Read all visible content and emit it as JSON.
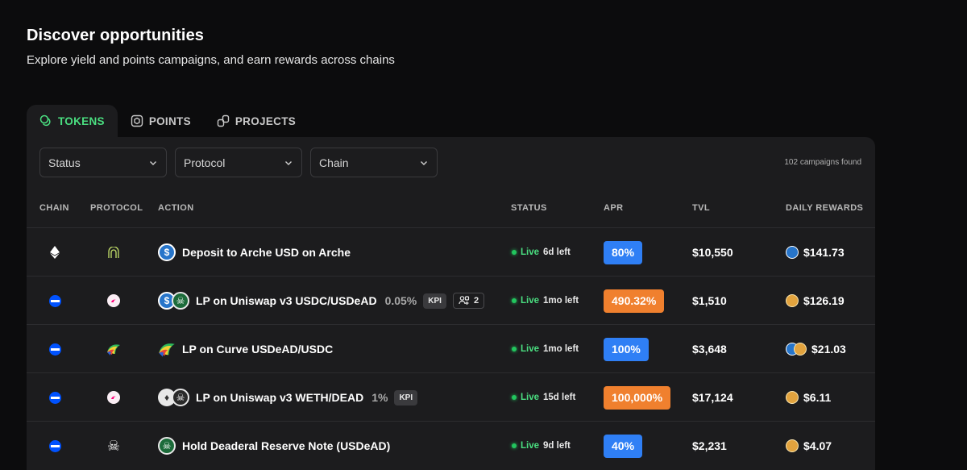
{
  "header": {
    "title": "Discover opportunities",
    "subtitle": "Explore yield and points campaigns, and earn rewards across chains"
  },
  "tabs": [
    {
      "label": "TOKENS",
      "icon": "coins-icon",
      "active": true
    },
    {
      "label": "POINTS",
      "icon": "box-icon",
      "active": false
    },
    {
      "label": "PROJECTS",
      "icon": "link-icon",
      "active": false
    }
  ],
  "filters": {
    "status": "Status",
    "protocol": "Protocol",
    "chain": "Chain",
    "count": "102 campaigns found"
  },
  "table": {
    "headers": {
      "chain": "CHAIN",
      "protocol": "PROTOCOL",
      "action": "ACTION",
      "status": "STATUS",
      "apr": "APR",
      "tvl": "TVL",
      "daily_rewards": "DAILY REWARDS"
    },
    "rows": [
      {
        "chain": "ethereum-icon",
        "protocol": "arche-icon",
        "action": "Deposit to Arche USD on Arche",
        "fee": "",
        "kpi": "",
        "members": "",
        "status": "Live",
        "time_left": "6d left",
        "apr": "80%",
        "apr_color": "#2f7ff5",
        "tvl": "$10,550",
        "reward": "$141.73"
      },
      {
        "chain": "base-icon",
        "protocol": "uniswap-icon",
        "action": "LP on Uniswap v3 USDC/USDeAD",
        "fee": "0.05%",
        "kpi": "KPI",
        "members": "2",
        "status": "Live",
        "time_left": "1mo left",
        "apr": "490.32%",
        "apr_color": "#f0802e",
        "tvl": "$1,510",
        "reward": "$126.19"
      },
      {
        "chain": "base-icon",
        "protocol": "curve-icon",
        "action": "LP on Curve USDeAD/USDC",
        "fee": "",
        "kpi": "",
        "members": "",
        "status": "Live",
        "time_left": "1mo left",
        "apr": "100%",
        "apr_color": "#2f7ff5",
        "tvl": "$3,648",
        "reward": "$21.03"
      },
      {
        "chain": "base-icon",
        "protocol": "uniswap-icon",
        "action": "LP on Uniswap v3 WETH/DEAD",
        "fee": "1%",
        "kpi": "KPI",
        "members": "",
        "status": "Live",
        "time_left": "15d left",
        "apr": "100,000%",
        "apr_color": "#f0802e",
        "tvl": "$17,124",
        "reward": "$6.11"
      },
      {
        "chain": "base-icon",
        "protocol": "skull-icon",
        "action": "Hold Deaderal Reserve Note (USDeAD)",
        "fee": "",
        "kpi": "",
        "members": "",
        "status": "Live",
        "time_left": "9d left",
        "apr": "40%",
        "apr_color": "#2f7ff5",
        "tvl": "$2,231",
        "reward": "$4.07"
      }
    ]
  }
}
